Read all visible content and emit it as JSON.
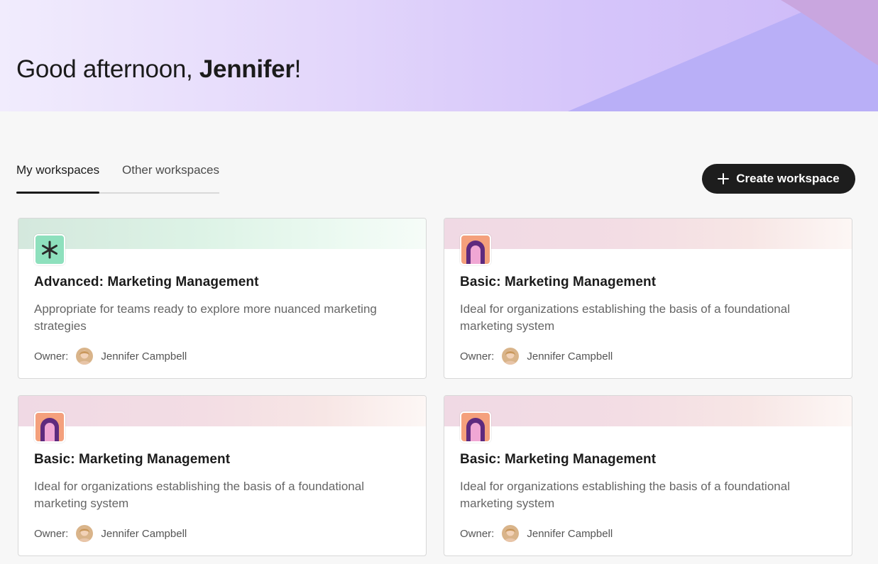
{
  "greeting": {
    "prefix": "Good afternoon, ",
    "name": "Jennifer",
    "suffix": "!"
  },
  "tabs": [
    {
      "label": "My workspaces",
      "active": true
    },
    {
      "label": "Other workspaces",
      "active": false
    }
  ],
  "create_button": {
    "label": "Create workspace",
    "icon": "plus-icon"
  },
  "cards": [
    {
      "title": "Advanced: Marketing Management",
      "description": "Appropriate for teams ready to explore more nuanced marketing strategies",
      "owner_label": "Owner:",
      "owner_name": "Jennifer Campbell",
      "icon": "asterisk-icon",
      "banner_color": "#ddf3e6"
    },
    {
      "title": "Basic: Marketing Management",
      "description": "Ideal for organizations establishing the basis of a foundational marketing system",
      "owner_label": "Owner:",
      "owner_name": "Jennifer Campbell",
      "icon": "arch-icon",
      "banner_color": "#f3dde4"
    },
    {
      "title": "Basic: Marketing Management",
      "description": "Ideal for organizations establishing the basis of a foundational marketing system",
      "owner_label": "Owner:",
      "owner_name": "Jennifer Campbell",
      "icon": "arch-icon",
      "banner_color": "#f3dde4"
    },
    {
      "title": "Basic: Marketing Management",
      "description": "Ideal for organizations establishing the basis of a foundational marketing system",
      "owner_label": "Owner:",
      "owner_name": "Jennifer Campbell",
      "icon": "arch-icon",
      "banner_color": "#f3dde4"
    }
  ],
  "colors": {
    "hero_start": "#f1ecfd",
    "hero_end": "#cdb9f8",
    "button_bg": "#1d1d1d",
    "icon_green": "#8ee0bd",
    "icon_orange": "#f4a07c",
    "icon_purple": "#5e2a7e"
  }
}
